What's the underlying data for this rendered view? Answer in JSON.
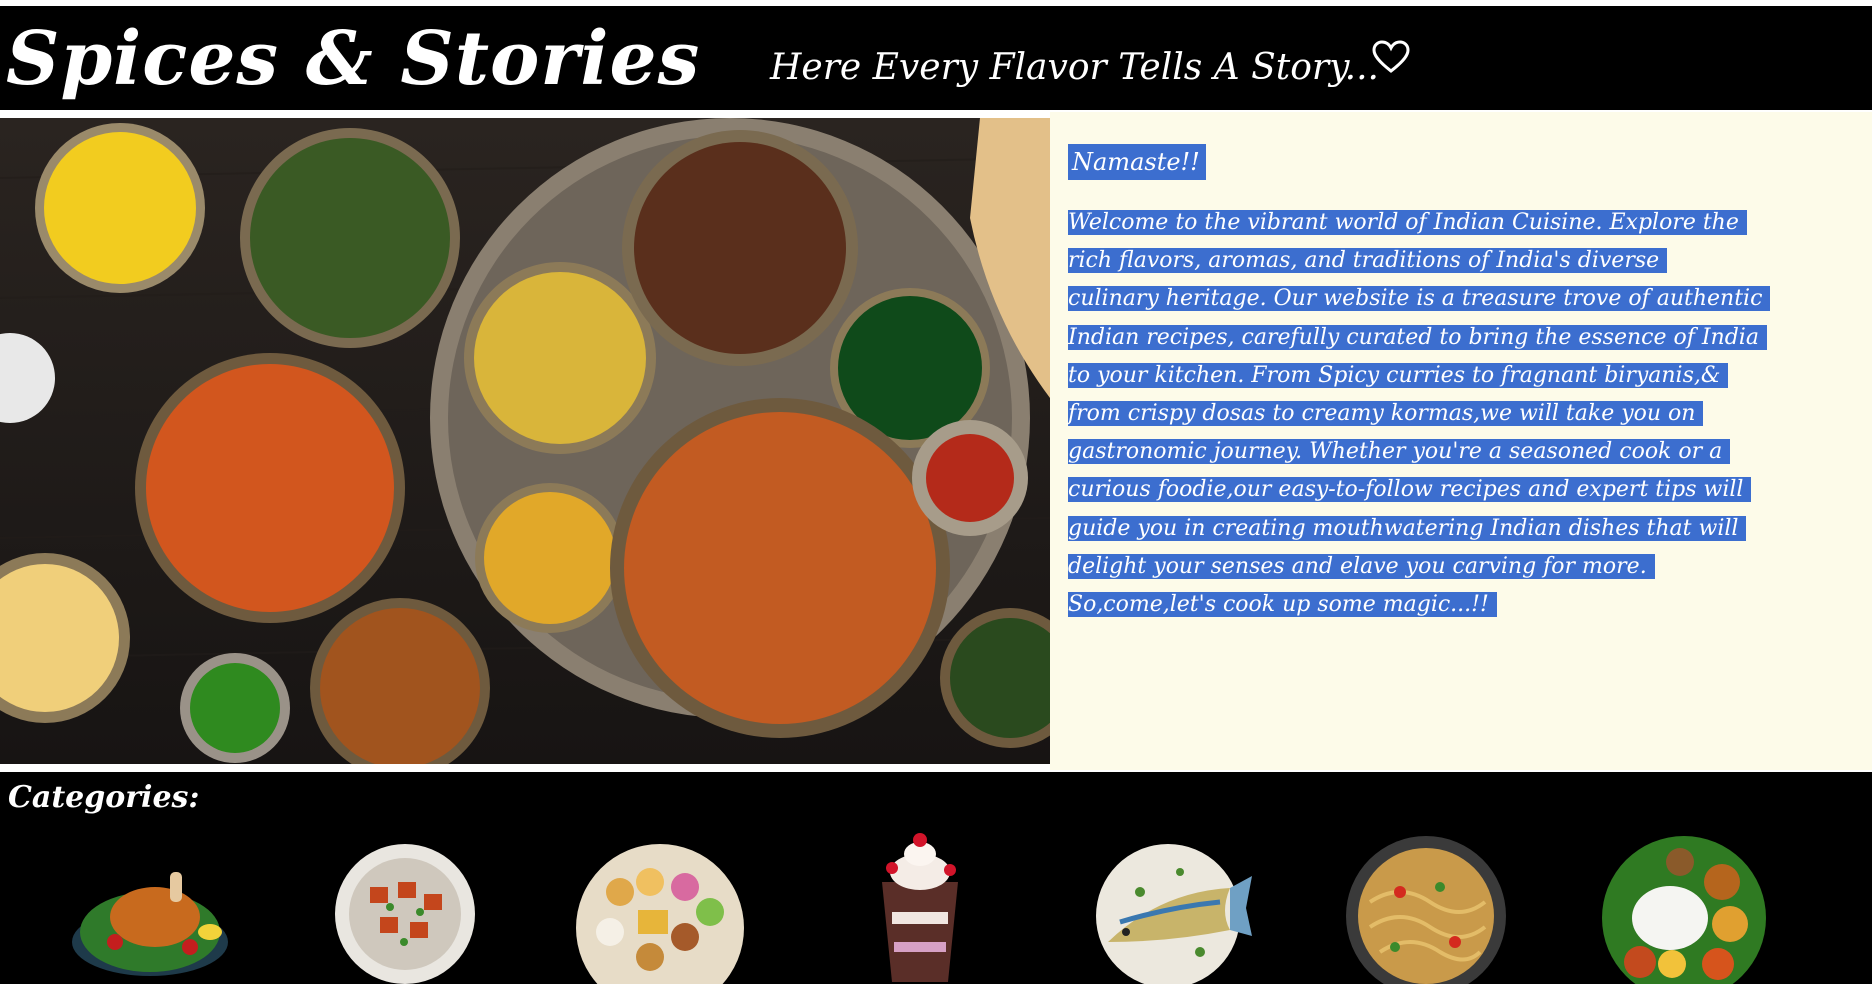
{
  "header": {
    "site_title": "Spices & Stories",
    "tagline": "Here Every Flavor Tells A Story...",
    "tagline_icon": "heart-icon"
  },
  "hero": {
    "image": "indian-thali-spread-photo"
  },
  "about": {
    "greeting": "Namaste!!",
    "intro_lines": [
      "Welcome to the vibrant world of Indian Cuisine. Explore the",
      "rich flavors, aromas, and traditions of India's diverse",
      "culinary heritage. Our website is a treasure trove of authentic",
      "Indian recipes, carefully curated to bring the essence of India",
      "to your kitchen. From Spicy curries to fragnant biryanis,&",
      "from crispy dosas to creamy kormas,we will take you on",
      "gastronomic journey. Whether you're a seasoned cook or a",
      "curious foodie,our easy-to-follow recipes and expert tips will",
      "guide you in creating mouthwatering Indian dishes that will",
      "delight your senses and elave you carving for more.",
      "So,come,let's cook up some magic...!!"
    ],
    "highlight_color": "#3c6ecf",
    "panel_color": "#fdfbe9"
  },
  "categories": {
    "heading": "Categories:",
    "items": [
      {
        "icon": "fried-chicken-plate-icon"
      },
      {
        "icon": "paneer-tikka-plate-icon"
      },
      {
        "icon": "sweets-platter-icon"
      },
      {
        "icon": "falooda-dessert-glass-icon"
      },
      {
        "icon": "fish-plate-icon"
      },
      {
        "icon": "noodles-bowl-icon"
      },
      {
        "icon": "south-indian-thali-icon"
      }
    ]
  }
}
